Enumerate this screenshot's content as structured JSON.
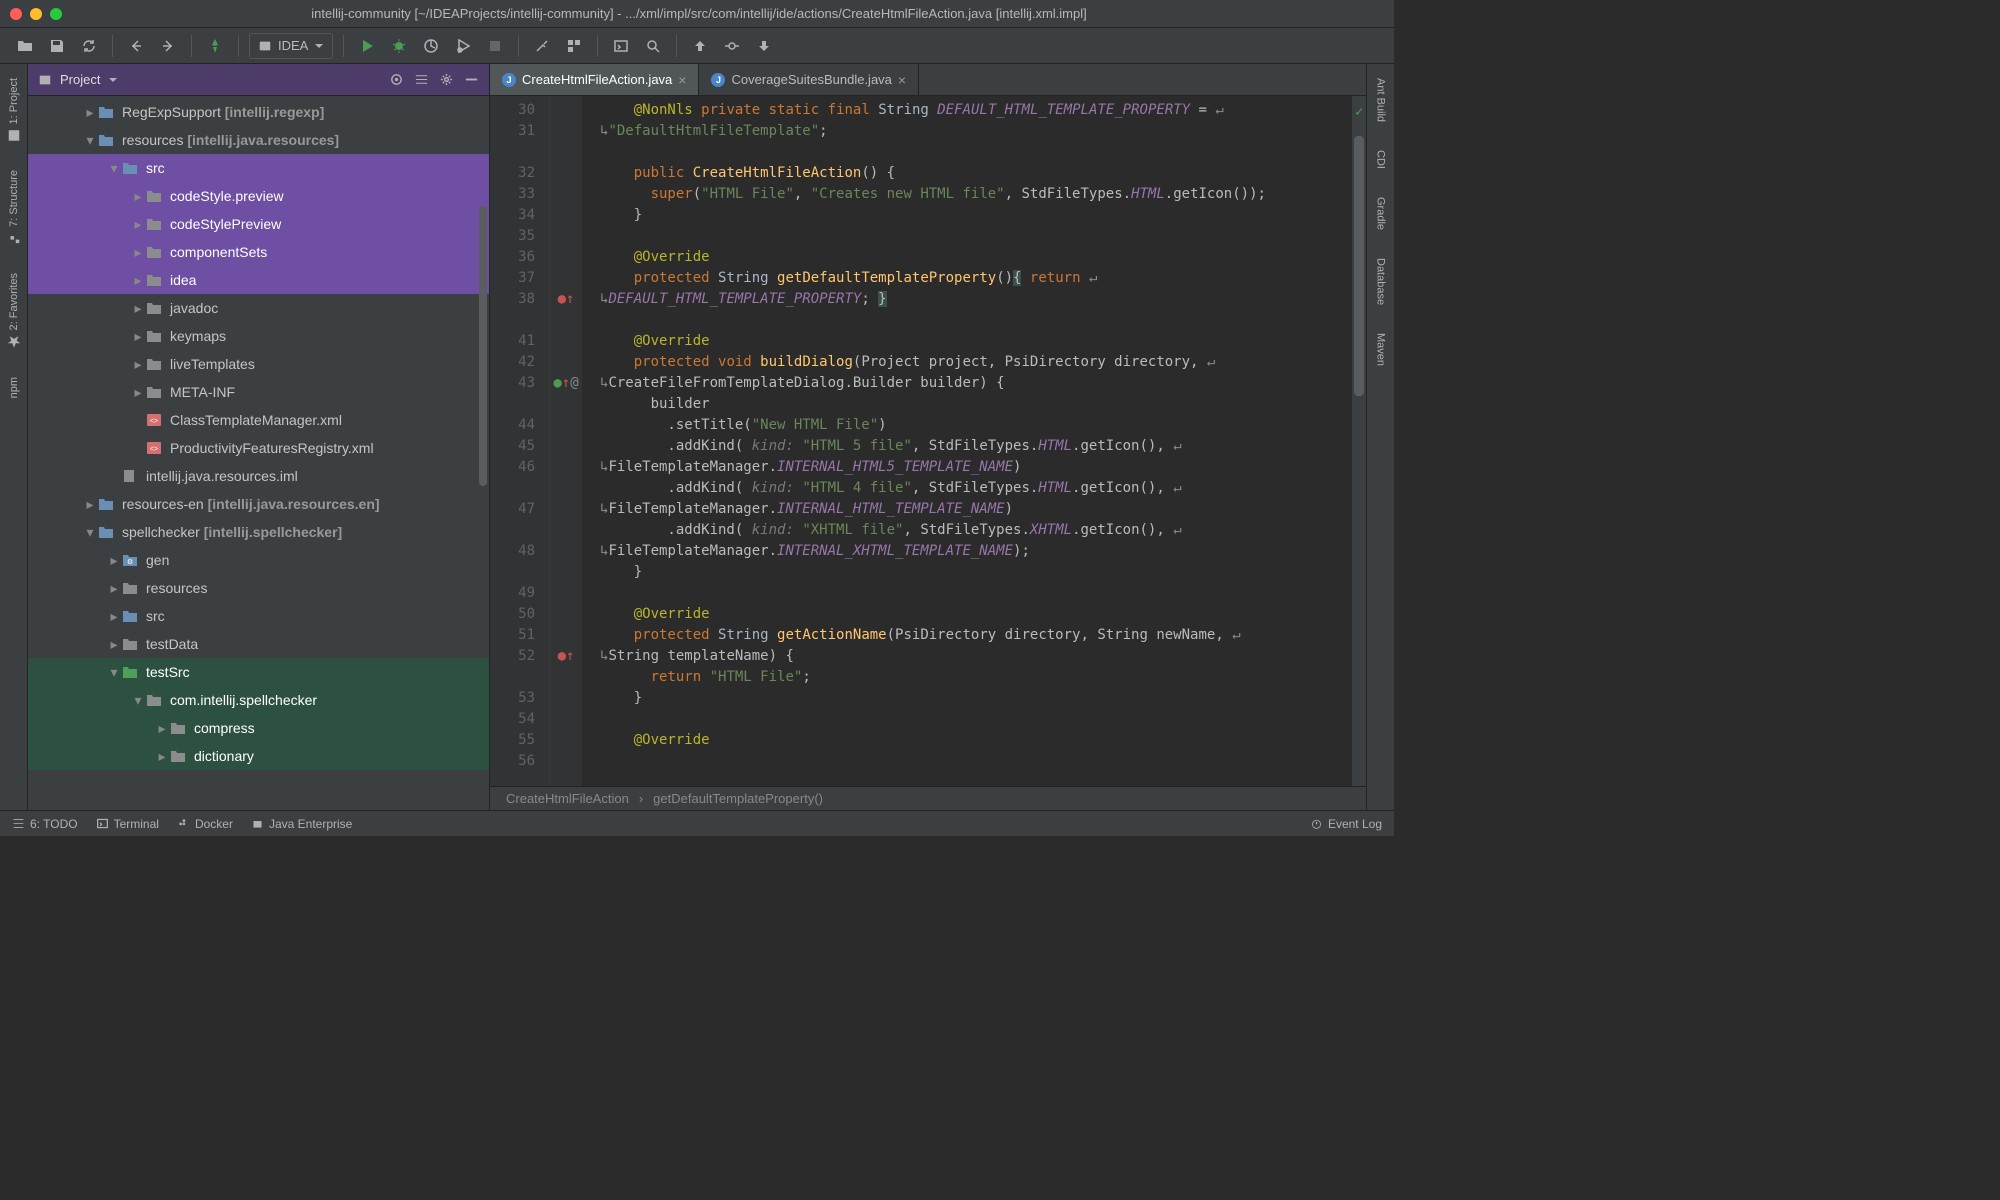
{
  "window": {
    "title": "intellij-community [~/IDEAProjects/intellij-community] - .../xml/impl/src/com/intellij/ide/actions/CreateHtmlFileAction.java [intellij.xml.impl]"
  },
  "runConfig": {
    "label": "IDEA"
  },
  "projectPanel": {
    "title": "Project"
  },
  "leftGutter": {
    "project": "1: Project",
    "structure": "7: Structure",
    "favorites": "2: Favorites",
    "npm": "npm"
  },
  "rightGutter": {
    "ant": "Ant Build",
    "cdi": "CDI",
    "gradle": "Gradle",
    "database": "Database",
    "maven": "Maven"
  },
  "tree": [
    {
      "depth": 1,
      "arrow": "r",
      "icon": "folder-blue",
      "label": "RegExpSupport",
      "bracket": "[intellij.regexp]"
    },
    {
      "depth": 1,
      "arrow": "d",
      "icon": "folder-blue",
      "label": "resources",
      "bracket": "[intellij.java.resources]",
      "sel": ""
    },
    {
      "depth": 2,
      "arrow": "d",
      "icon": "folder-blue",
      "label": "src",
      "sel": "purple"
    },
    {
      "depth": 3,
      "arrow": "r",
      "icon": "folder-gray",
      "label": "codeStyle.preview",
      "sel": "purple"
    },
    {
      "depth": 3,
      "arrow": "r",
      "icon": "folder-gray",
      "label": "codeStylePreview",
      "sel": "purple"
    },
    {
      "depth": 3,
      "arrow": "r",
      "icon": "folder-gray",
      "label": "componentSets",
      "sel": "purple"
    },
    {
      "depth": 3,
      "arrow": "r",
      "icon": "folder-gray",
      "label": "idea",
      "sel": "purple"
    },
    {
      "depth": 3,
      "arrow": "r",
      "icon": "folder-gray",
      "label": "javadoc"
    },
    {
      "depth": 3,
      "arrow": "r",
      "icon": "folder-gray",
      "label": "keymaps"
    },
    {
      "depth": 3,
      "arrow": "r",
      "icon": "folder-gray",
      "label": "liveTemplates"
    },
    {
      "depth": 3,
      "arrow": "r",
      "icon": "folder-gray",
      "label": "META-INF"
    },
    {
      "depth": 3,
      "arrow": "",
      "icon": "xml",
      "label": "ClassTemplateManager.xml"
    },
    {
      "depth": 3,
      "arrow": "",
      "icon": "xml",
      "label": "ProductivityFeaturesRegistry.xml"
    },
    {
      "depth": 2,
      "arrow": "",
      "icon": "iml",
      "label": "intellij.java.resources.iml"
    },
    {
      "depth": 1,
      "arrow": "r",
      "icon": "folder-blue",
      "label": "resources-en",
      "bracket": "[intellij.java.resources.en]"
    },
    {
      "depth": 1,
      "arrow": "d",
      "icon": "folder-blue",
      "label": "spellchecker",
      "bracket": "[intellij.spellchecker]"
    },
    {
      "depth": 2,
      "arrow": "r",
      "icon": "folder-gen",
      "label": "gen"
    },
    {
      "depth": 2,
      "arrow": "r",
      "icon": "folder-gray",
      "label": "resources"
    },
    {
      "depth": 2,
      "arrow": "r",
      "icon": "folder-blue",
      "label": "src"
    },
    {
      "depth": 2,
      "arrow": "r",
      "icon": "folder-gray",
      "label": "testData"
    },
    {
      "depth": 2,
      "arrow": "d",
      "icon": "folder-green",
      "label": "testSrc",
      "sel": "green"
    },
    {
      "depth": 3,
      "arrow": "d",
      "icon": "folder-gray",
      "label": "com.intellij.spellchecker",
      "sel": "green"
    },
    {
      "depth": 4,
      "arrow": "r",
      "icon": "folder-gray",
      "label": "compress",
      "sel": "green"
    },
    {
      "depth": 4,
      "arrow": "r",
      "icon": "folder-gray",
      "label": "dictionary",
      "sel": "green"
    }
  ],
  "tabs": [
    {
      "label": "CreateHtmlFileAction.java",
      "active": true
    },
    {
      "label": "CoverageSuitesBundle.java",
      "active": false
    }
  ],
  "lineNumbers": [
    "30",
    "31",
    "",
    "32",
    "33",
    "34",
    "35",
    "36",
    "37",
    "38",
    "",
    "41",
    "42",
    "43",
    "",
    "44",
    "45",
    "46",
    "",
    "47",
    "",
    "48",
    "",
    "49",
    "50",
    "51",
    "52",
    "",
    "53",
    "54",
    "55",
    "56",
    ""
  ],
  "code": {
    "l30": {
      "anno": "@NonNls",
      "kw1": "private",
      "kw2": "static",
      "kw3": "final",
      "type": "String",
      "const": "DEFAULT_HTML_TEMPLATE_PROPERTY",
      "eq": " = "
    },
    "l30b": {
      "str": "\"DefaultHtmlFileTemplate\"",
      "semi": ";"
    },
    "l32": {
      "kw": "public",
      "fn": "CreateHtmlFileAction",
      "paren": "() {"
    },
    "l33": {
      "kw": "super",
      "open": "(",
      "s1": "\"HTML File\"",
      "c1": ", ",
      "s2": "\"Creates new HTML file\"",
      "c2": ", StdFileTypes.",
      "const": "HTML",
      "rest": ".getIcon());"
    },
    "l34": {
      "brace": "}"
    },
    "l36": {
      "anno": "@Override"
    },
    "l37": {
      "kw": "protected",
      "type": "String",
      "fn": "getDefaultTemplateProperty",
      "paren": "()",
      "brace": " { ",
      "kw2": "return"
    },
    "l37b": {
      "const": "DEFAULT_HTML_TEMPLATE_PROPERTY",
      "rest": "; }"
    },
    "l41": {
      "anno": "@Override"
    },
    "l42": {
      "kw": "protected",
      "kw2": "void",
      "fn": "buildDialog",
      "sig": "(Project project, PsiDirectory directory, "
    },
    "l42b": {
      "sig": "CreateFileFromTemplateDialog.Builder builder) {"
    },
    "l43": {
      "txt": "builder"
    },
    "l44": {
      "fn": ".setTitle",
      "open": "(",
      "str": "\"New HTML File\"",
      "close": ")"
    },
    "l45": {
      "fn": ".addKind",
      "open": "(",
      "hint": " kind: ",
      "str": "\"HTML 5 file\"",
      "mid": ", StdFileTypes.",
      "const": "HTML",
      "rest": ".getIcon(), "
    },
    "l45b": {
      "pre": "FileTemplateManager.",
      "const": "INTERNAL_HTML5_TEMPLATE_NAME",
      "close": ")"
    },
    "l46": {
      "fn": ".addKind",
      "open": "(",
      "hint": " kind: ",
      "str": "\"HTML 4 file\"",
      "mid": ", StdFileTypes.",
      "const": "HTML",
      "rest": ".getIcon(), "
    },
    "l46b": {
      "pre": "FileTemplateManager.",
      "const": "INTERNAL_HTML_TEMPLATE_NAME",
      "close": ")"
    },
    "l47": {
      "fn": ".addKind",
      "open": "(",
      "hint": " kind: ",
      "str": "\"XHTML file\"",
      "mid": ", StdFileTypes.",
      "const": "XHTML",
      "rest": ".getIcon(), "
    },
    "l47b": {
      "pre": "FileTemplateManager.",
      "const": "INTERNAL_XHTML_TEMPLATE_NAME",
      "close": ");"
    },
    "l48": {
      "brace": "}"
    },
    "l50": {
      "anno": "@Override"
    },
    "l51": {
      "kw": "protected",
      "type": "String",
      "fn": "getActionName",
      "sig": "(PsiDirectory directory, String newName, "
    },
    "l51b": {
      "sig": "String templateName) {"
    },
    "l52": {
      "kw": "return",
      "str": "\"HTML File\"",
      "semi": ";"
    },
    "l53": {
      "brace": "}"
    },
    "l55": {
      "anno": "@Override"
    }
  },
  "breadcrumb": {
    "a": "CreateHtmlFileAction",
    "b": "getDefaultTemplateProperty()"
  },
  "status": {
    "todo": "6: TODO",
    "terminal": "Terminal",
    "docker": "Docker",
    "jee": "Java Enterprise",
    "eventlog": "Event Log"
  }
}
